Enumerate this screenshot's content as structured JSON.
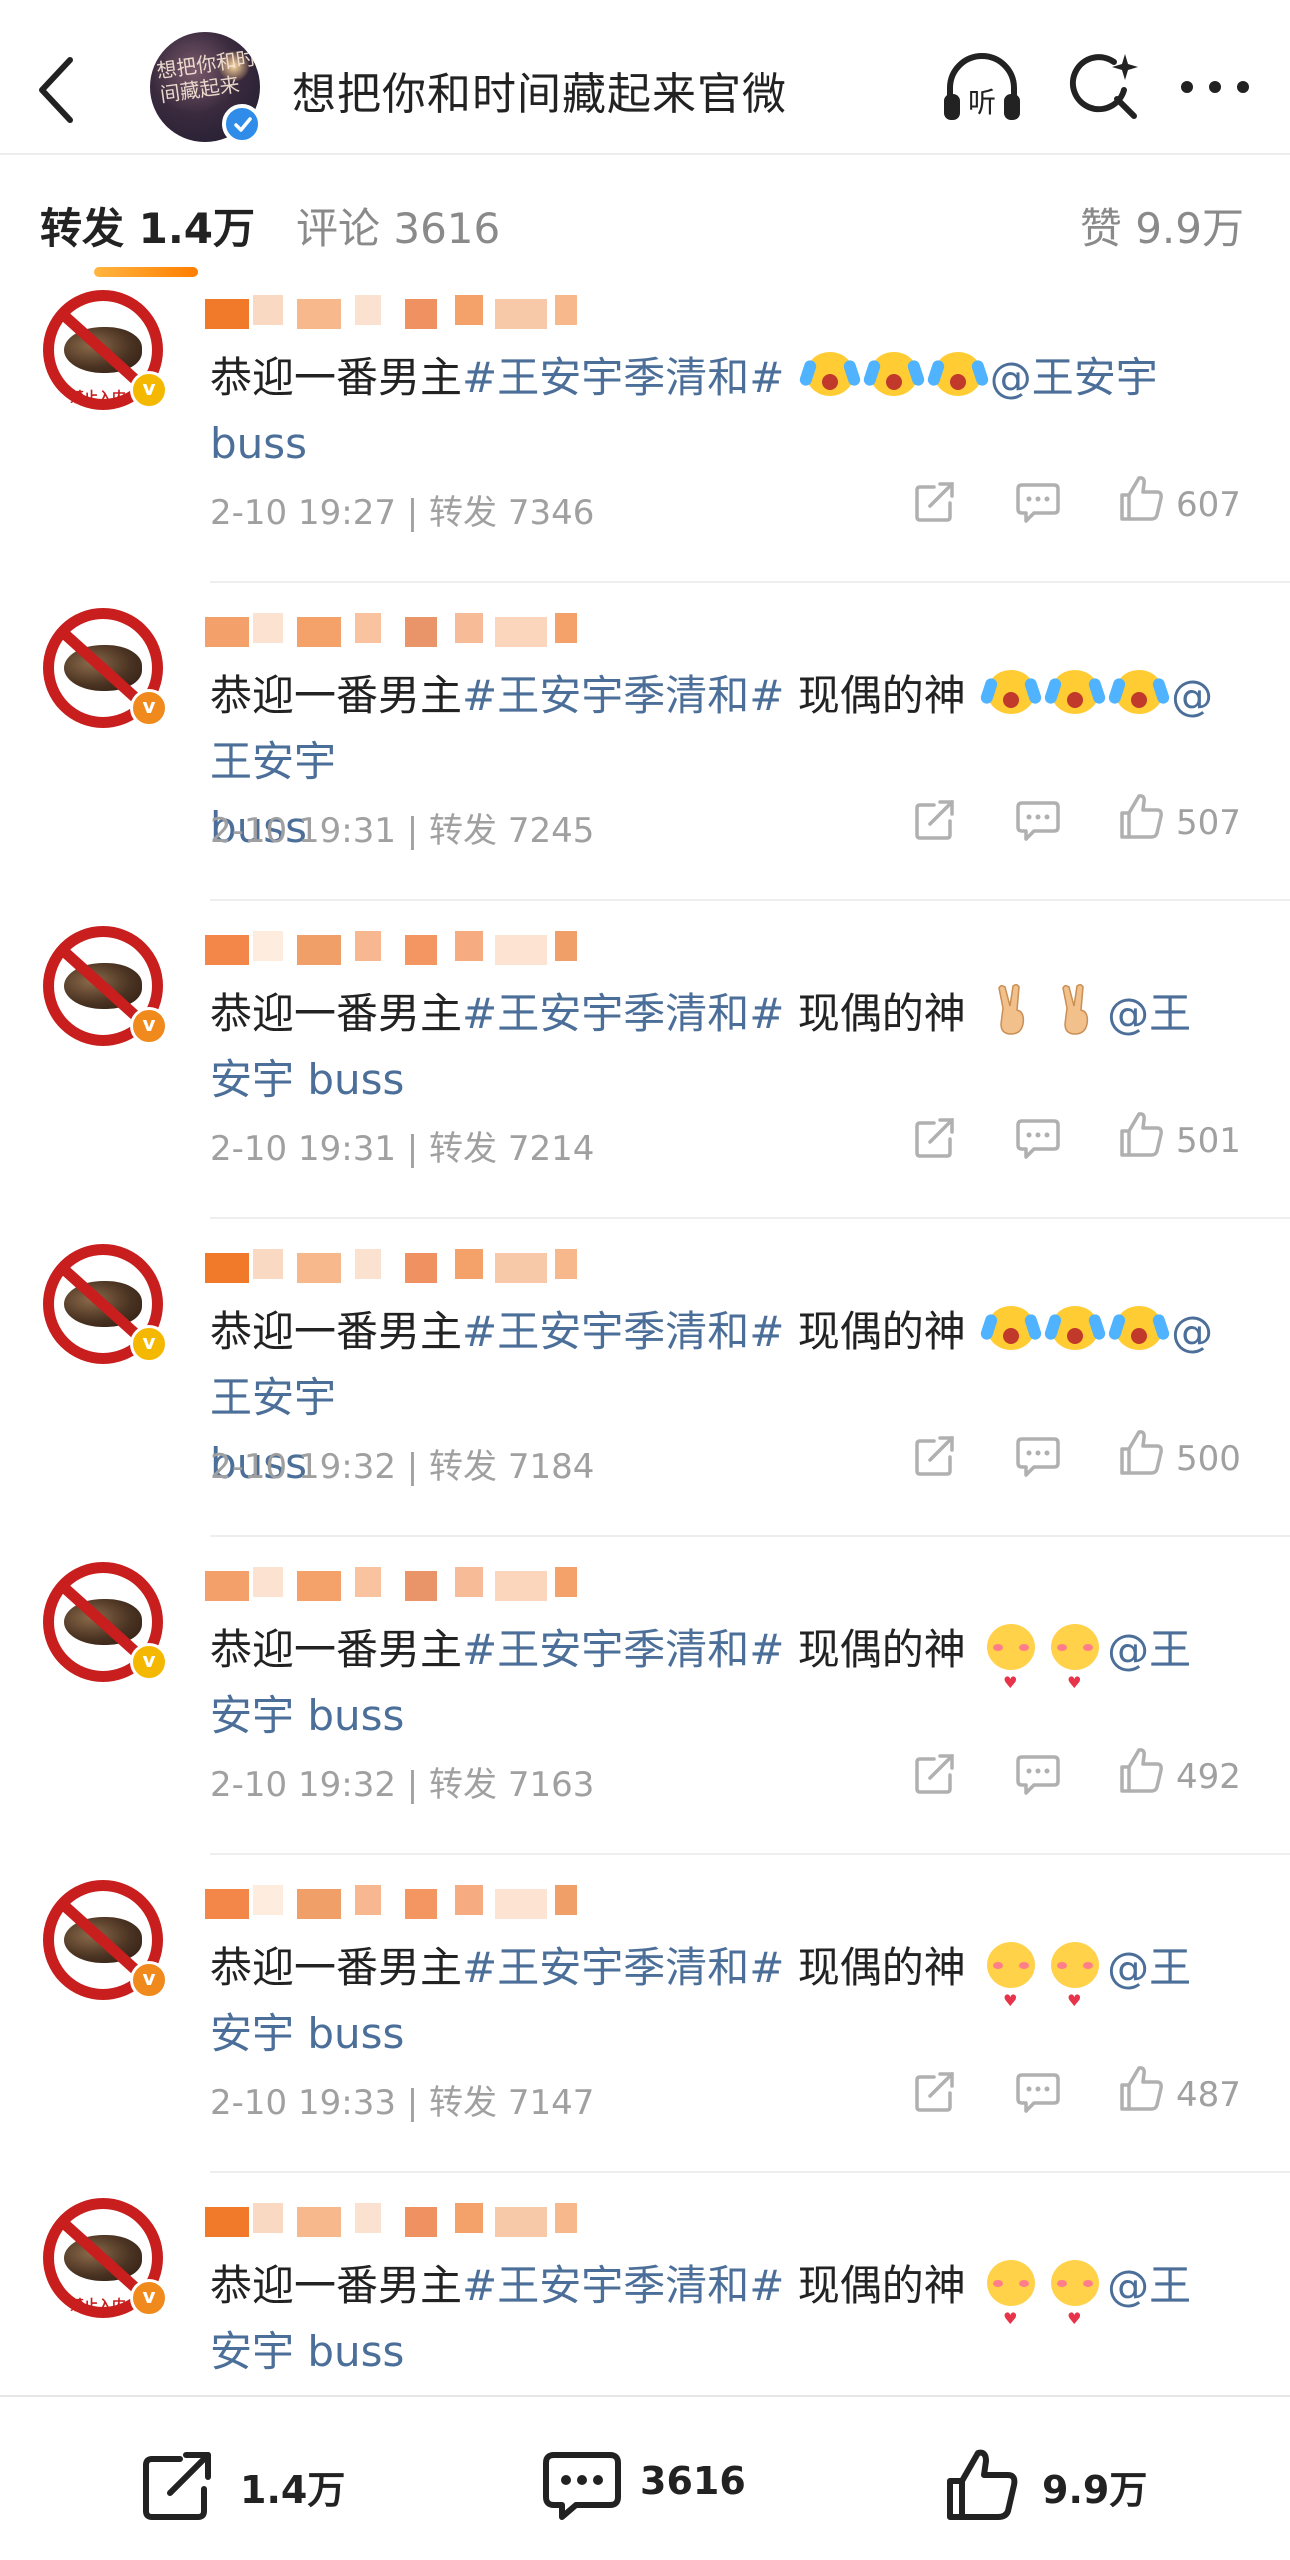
{
  "header": {
    "title": "想把你和时间藏起来官微",
    "avatar_text": "想把你和时间藏起来",
    "back_icon": "back-arrow-icon",
    "listen_label": "听",
    "search_icon": "search-icon",
    "more_icon": "more-icon"
  },
  "tabs": {
    "repost": "转发 1.4万",
    "comment": "评论 3616",
    "like": "赞 9.9万"
  },
  "avatar_caption": "禁止入内",
  "reposts": [
    {
      "badge_color": "#f5b800",
      "text_pre": "恭迎一番男主",
      "tag": "#王安宇季清和#",
      "text_mid": "",
      "emoji": "cry",
      "emoji_count": 3,
      "mention_a": "@王安宇",
      "mention_b": "buss",
      "time": "2-10 19:27",
      "repost_label": "转发 7346",
      "likes": "607"
    },
    {
      "badge_color": "#f08a1c",
      "text_pre": "恭迎一番男主",
      "tag": "#王安宇季清和#",
      "text_mid": " 现偶的神",
      "emoji": "cry",
      "emoji_count": 3,
      "mention_a": "@王安宇",
      "mention_b": "buss",
      "time": "2-10 19:31",
      "repost_label": "转发 7245",
      "likes": "507"
    },
    {
      "badge_color": "#f08a1c",
      "text_pre": "恭迎一番男主",
      "tag": "#王安宇季清和#",
      "text_mid": " 现偶的神",
      "emoji": "hand",
      "emoji_count": 2,
      "mention_a": "@王",
      "mention_b": "安宇 buss",
      "time": "2-10 19:31",
      "repost_label": "转发 7214",
      "likes": "501"
    },
    {
      "badge_color": "#f5b800",
      "text_pre": "恭迎一番男主",
      "tag": "#王安宇季清和#",
      "text_mid": " 现偶的神",
      "emoji": "cry",
      "emoji_count": 3,
      "mention_a": "@王安宇",
      "mention_b": "buss",
      "time": "2-10 19:32",
      "repost_label": "转发 7184",
      "likes": "500"
    },
    {
      "badge_color": "#f5b800",
      "text_pre": "恭迎一番男主",
      "tag": "#王安宇季清和#",
      "text_mid": " 现偶的神",
      "emoji": "blush",
      "emoji_count": 2,
      "mention_a": "@王",
      "mention_b": "安宇 buss",
      "time": "2-10 19:32",
      "repost_label": "转发 7163",
      "likes": "492"
    },
    {
      "badge_color": "#f08a1c",
      "text_pre": "恭迎一番男主",
      "tag": "#王安宇季清和#",
      "text_mid": " 现偶的神",
      "emoji": "blush",
      "emoji_count": 2,
      "mention_a": "@王",
      "mention_b": "安宇 buss",
      "time": "2-10 19:33",
      "repost_label": "转发 7147",
      "likes": "487"
    },
    {
      "badge_color": "#f08a1c",
      "text_pre": "恭迎一番男主",
      "tag": "#王安宇季清和#",
      "text_mid": " 现偶的神",
      "emoji": "blush",
      "emoji_count": 2,
      "mention_a": "@王",
      "mention_b": "安宇 buss",
      "time": "",
      "repost_label": "",
      "likes": ""
    }
  ],
  "bottom_bar": {
    "repost_count": "1.4万",
    "comment_count": "3616",
    "like_count": "9.9万"
  },
  "colors": {
    "link": "#4c6f99",
    "accent_orange": "#ff8200",
    "muted": "#a0a0a0"
  }
}
